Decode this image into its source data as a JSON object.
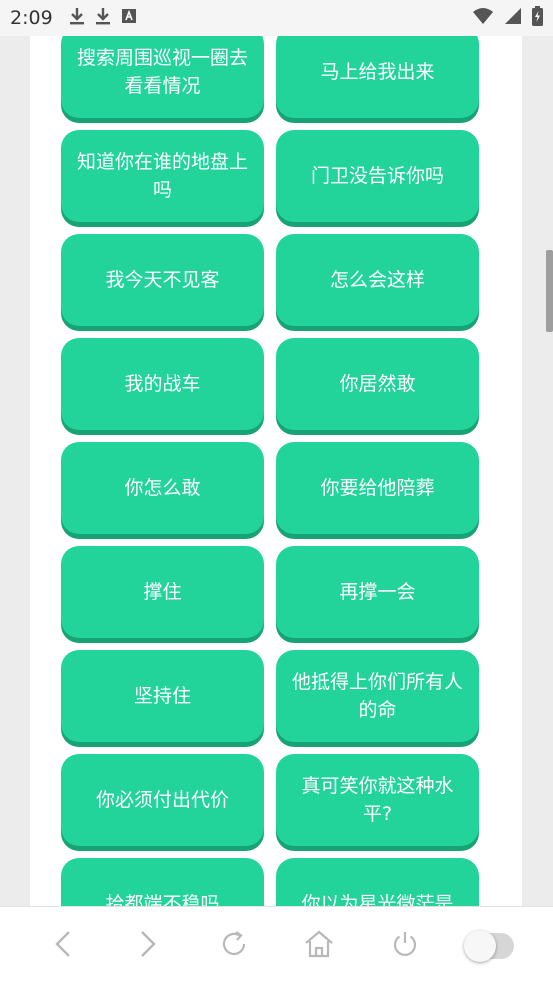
{
  "status": {
    "time": "2:09"
  },
  "buttons": [
    "搜索周围巡视一圈去看看情况",
    "马上给我出来",
    "知道你在谁的地盘上吗",
    "门卫没告诉你吗",
    "我今天不见客",
    "怎么会这样",
    "我的战车",
    "你居然敢",
    "你怎么敢",
    "你要给他陪葬",
    "撑住",
    "再撑一会",
    "坚持住",
    "他抵得上你们所有人的命",
    "你必须付出代价",
    "真可笑你就这种水平?",
    "拾都端不稳吗",
    "你以为星光微茫是"
  ],
  "colors": {
    "button": "#22d39a",
    "button_shadow": "#17a374"
  },
  "icons": {
    "status_left": [
      "download-icon",
      "download-icon",
      "a-box-icon"
    ],
    "status_right": [
      "wifi-icon",
      "signal-icon",
      "battery-icon"
    ],
    "nav": [
      "back-icon",
      "forward-icon",
      "reload-icon",
      "home-icon",
      "power-icon",
      "toggle-switch"
    ]
  }
}
